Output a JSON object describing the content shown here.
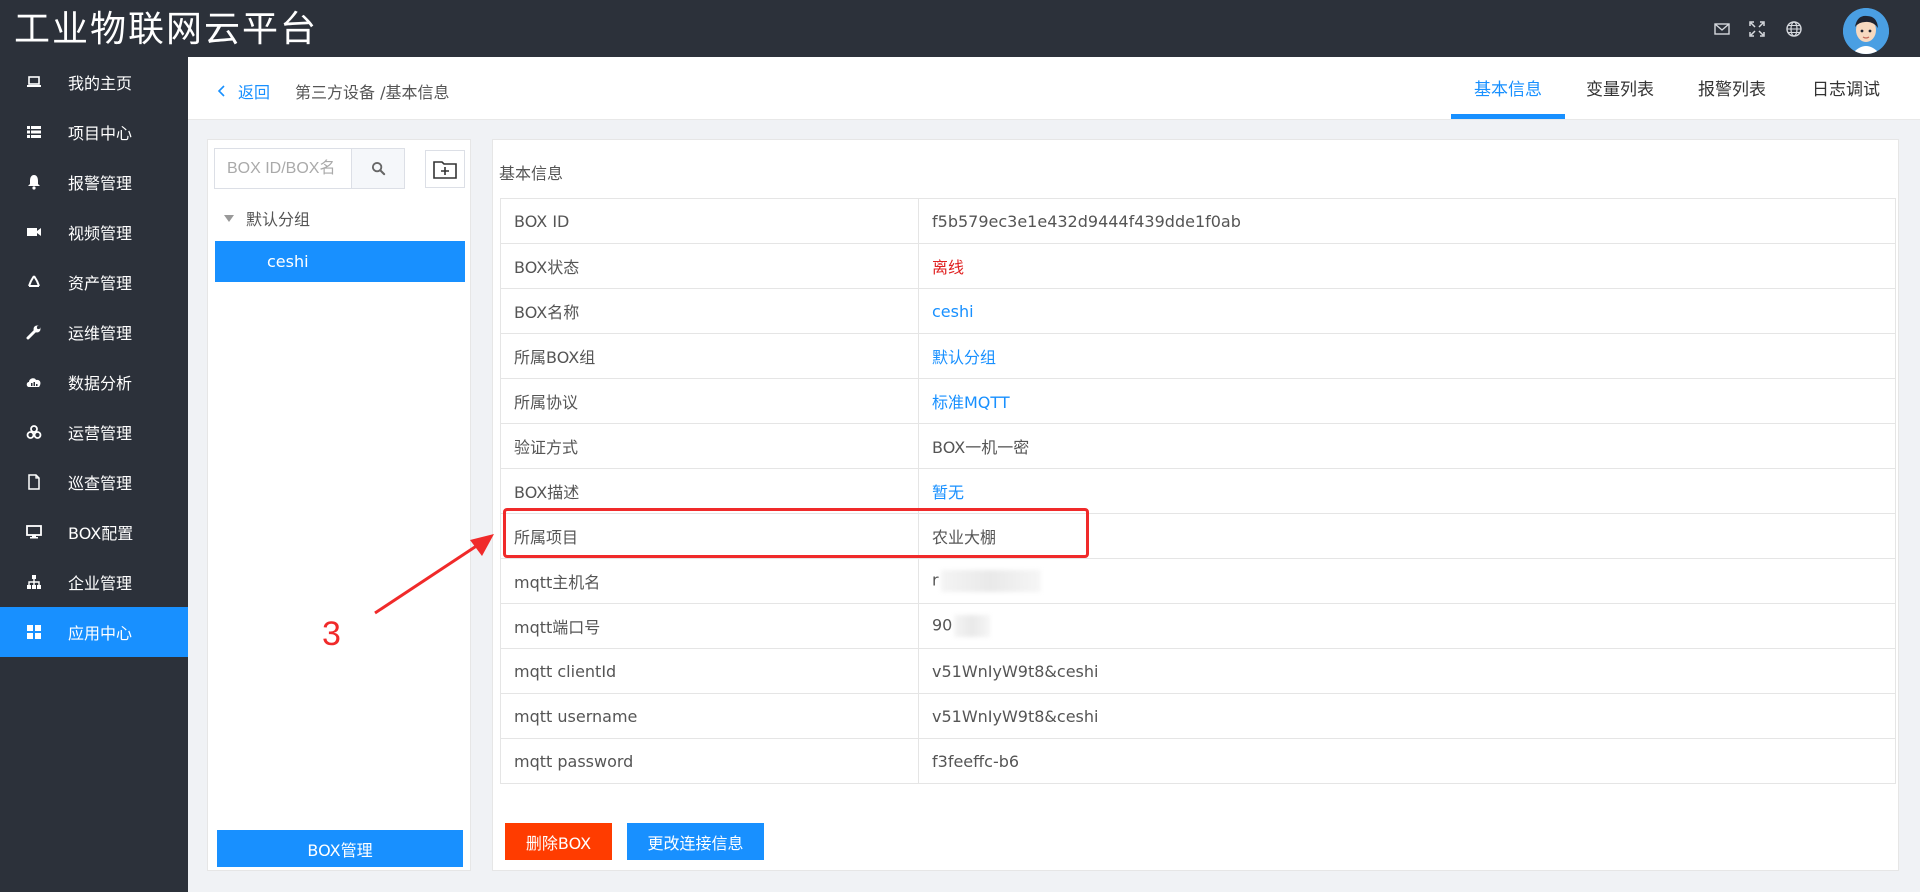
{
  "header": {
    "brand": "工业物联网云平台",
    "icons": [
      "mail-icon",
      "fullscreen-icon",
      "globe-icon"
    ]
  },
  "sidebar": {
    "items": [
      {
        "label": "我的主页",
        "icon": "laptop-icon"
      },
      {
        "label": "项目中心",
        "icon": "list-icon"
      },
      {
        "label": "报警管理",
        "icon": "bell-icon"
      },
      {
        "label": "视频管理",
        "icon": "video-camera-icon"
      },
      {
        "label": "资产管理",
        "icon": "recycle-icon"
      },
      {
        "label": "运维管理",
        "icon": "wrench-icon"
      },
      {
        "label": "数据分析",
        "icon": "cloud-chart-icon"
      },
      {
        "label": "运营管理",
        "icon": "cubes-icon"
      },
      {
        "label": "巡查管理",
        "icon": "file-icon"
      },
      {
        "label": "BOX配置",
        "icon": "desktop-icon"
      },
      {
        "label": "企业管理",
        "icon": "sitemap-icon"
      },
      {
        "label": "应用中心",
        "icon": "grid-icon"
      }
    ],
    "active_index": 11
  },
  "topbar": {
    "back_label": "返回",
    "breadcrumb": "第三方设备 /基本信息",
    "tabs": [
      {
        "label": "基本信息"
      },
      {
        "label": "变量列表"
      },
      {
        "label": "报警列表"
      },
      {
        "label": "日志调试"
      }
    ],
    "active_tab": 0
  },
  "left_panel": {
    "search_placeholder": "BOX ID/BOX名",
    "group_label": "默认分组",
    "selected_item": "ceshi",
    "box_manage_label": "BOX管理"
  },
  "info": {
    "title": "基本信息",
    "rows": [
      {
        "label": "BOX ID",
        "value": "f5b579ec3e1e432d9444f439dde1f0ab"
      },
      {
        "label": "BOX状态",
        "value": "离线"
      },
      {
        "label": "BOX名称",
        "value": "ceshi"
      },
      {
        "label": "所属BOX组",
        "value": "默认分组"
      },
      {
        "label": "所属协议",
        "value": "标准MQTT"
      },
      {
        "label": "验证方式",
        "value": "BOX一机一密"
      },
      {
        "label": "BOX描述",
        "value": "暂无"
      },
      {
        "label": "所属项目",
        "value": "农业大棚"
      },
      {
        "label": "mqtt主机名",
        "value": "r"
      },
      {
        "label": "mqtt端口号",
        "value": "90"
      },
      {
        "label": "mqtt clientId",
        "value": "v51WnIyW9t8&ceshi"
      },
      {
        "label": "mqtt username",
        "value": "v51WnIyW9t8&ceshi"
      },
      {
        "label": "mqtt password",
        "value": "f3feeffc-b6"
      }
    ],
    "delete_label": "删除BOX",
    "update_label": "更改连接信息"
  },
  "annotation": {
    "step_number": "3",
    "color": "#f02a2a"
  },
  "colors": {
    "primary": "#1890ff",
    "dark_bg": "#2c313a",
    "danger": "#ff3c00",
    "offline": "#e02020"
  }
}
